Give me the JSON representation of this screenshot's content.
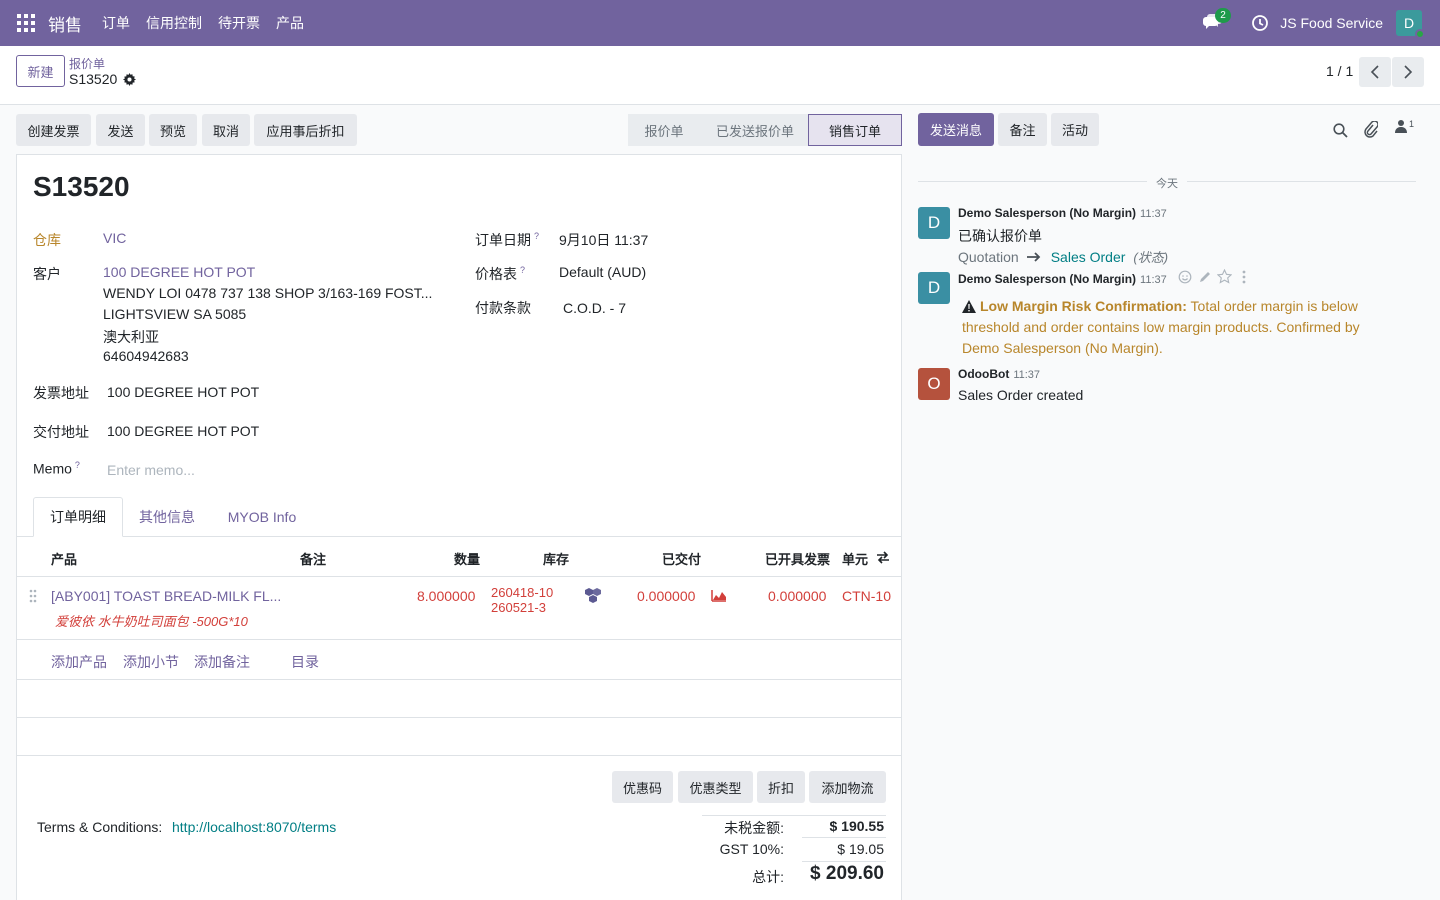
{
  "navbar": {
    "app_name": "销售",
    "menus": [
      "订单",
      "信用控制",
      "待开票",
      "产品"
    ],
    "chat_count": "2",
    "company": "JS Food Service",
    "user_initial": "D"
  },
  "control": {
    "new_button": "新建",
    "breadcrumb_parent": "报价单",
    "breadcrumb_current": "S13520",
    "pager": "1 / 1"
  },
  "actions": [
    "创建发票",
    "发送",
    "预览",
    "取消",
    "应用事后折扣"
  ],
  "stages": [
    "报价单",
    "已发送报价单",
    "销售订单"
  ],
  "form": {
    "title": "S13520",
    "warehouse_label": "仓库",
    "warehouse": "VIC",
    "customer_label": "客户",
    "customer_name": "100 DEGREE HOT POT",
    "customer_address": [
      "WENDY LOI 0478 737 138 SHOP 3/163-169 FOST...",
      "LIGHTSVIEW SA 5085",
      "澳大利亚",
      "64604942683"
    ],
    "invoice_addr_label": "发票地址",
    "invoice_addr": "100 DEGREE HOT POT",
    "delivery_addr_label": "交付地址",
    "delivery_addr": "100 DEGREE HOT POT",
    "memo_label": "Memo",
    "memo_placeholder": "Enter memo...",
    "order_date_label": "订单日期",
    "order_date": "9月10日 11:37",
    "pricelist_label": "价格表",
    "pricelist": "Default (AUD)",
    "payment_terms_label": "付款条款",
    "payment_terms": "C.O.D. - 7",
    "help_mark": "?"
  },
  "tabs": [
    "订单明细",
    "其他信息",
    "MYOB Info"
  ],
  "table": {
    "headers": [
      "产品",
      "备注",
      "数量",
      "库存",
      "已交付",
      "已开具发票",
      "单元"
    ],
    "row": {
      "product": "[ABY001] TOAST BREAD-MILK FL...",
      "product_desc": "爱彼依 水牛奶吐司面包 -500G*10",
      "qty": "8.000000",
      "lots": [
        "260418-10",
        "260521-3"
      ],
      "delivered": "0.000000",
      "invoiced": "0.000000",
      "unit": "CTN-10"
    },
    "add_links": [
      "添加产品",
      "添加小节",
      "添加备注",
      "目录"
    ]
  },
  "footer": {
    "buttons": [
      "优惠码",
      "优惠类型",
      "折扣",
      "添加物流"
    ],
    "terms_label": "Terms & Conditions:",
    "terms_link": "http://localhost:8070/terms",
    "untaxed_label": "未税金额:",
    "untaxed": "$ 190.55",
    "gst_label": "GST 10%:",
    "gst": "$ 19.05",
    "total_label": "总计:",
    "total": "$ 209.60"
  },
  "chatter": {
    "buttons": [
      "发送消息",
      "备注",
      "活动"
    ],
    "followers": "1",
    "today": "今天",
    "messages": [
      {
        "initial": "D",
        "author": "Demo Salesperson (No Margin)",
        "time": "11:37",
        "body": "已确认报价单",
        "tracking_old": "Quotation",
        "tracking_new": "Sales Order",
        "tracking_field": "(状态)"
      },
      {
        "initial": "D",
        "author": "Demo Salesperson (No Margin)",
        "time": "11:37",
        "warning_title": "Low Margin Risk Confirmation:",
        "warning_text_1": "Total order margin is below",
        "warning_text_2": "threshold and order contains low margin products. Confirmed by",
        "warning_text_3": "Demo Salesperson (No Margin)."
      },
      {
        "initial": "O",
        "author": "OdooBot",
        "time": "11:37",
        "body": "Sales Order created"
      }
    ]
  },
  "colors": {
    "brand": "#71639e",
    "warning": "#b8862b",
    "danger": "#d23f3a",
    "teal": "#017e84"
  }
}
